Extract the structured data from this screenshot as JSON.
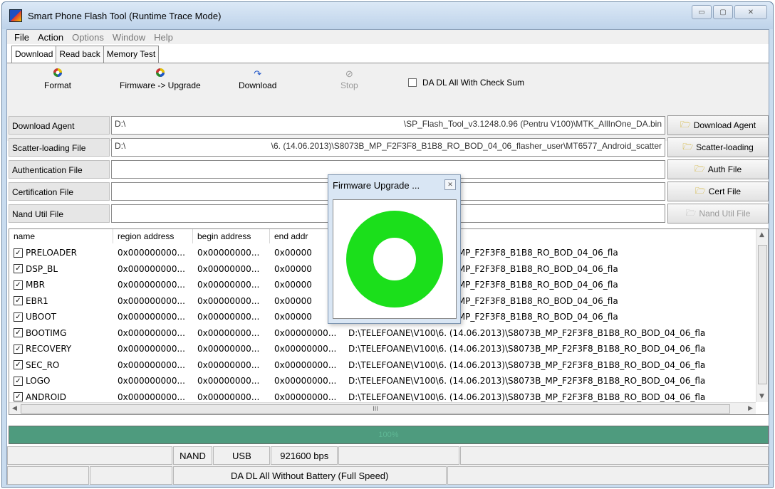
{
  "window": {
    "title": "Smart Phone Flash Tool (Runtime Trace Mode)",
    "minimize_glyph": "▭",
    "maximize_glyph": "▢",
    "close_glyph": "✕"
  },
  "menu": [
    "File",
    "Action",
    "Options",
    "Window",
    "Help"
  ],
  "tabs": [
    "Download",
    "Read back",
    "Memory Test"
  ],
  "toolbar": {
    "format": "Format",
    "firmware_upgrade": "Firmware -> Upgrade",
    "download": "Download",
    "stop": "Stop",
    "checksum_label": "DA DL All With Check Sum",
    "checksum_checked": false
  },
  "files": [
    {
      "label": "Download Agent",
      "path_left": "D:\\",
      "path_right": "\\SP_Flash_Tool_v3.1248.0.96 (Pentru V100)\\MTK_AllInOne_DA.bin",
      "button": "Download Agent",
      "enabled": true
    },
    {
      "label": "Scatter-loading File",
      "path_left": "D:\\",
      "path_right": "\\6. (14.06.2013)\\S8073B_MP_F2F3F8_B1B8_RO_BOD_04_06_flasher_user\\MT6577_Android_scatter",
      "button": "Scatter-loading",
      "enabled": true
    },
    {
      "label": "Authentication File",
      "path_left": "",
      "path_right": "",
      "button": "Auth File",
      "enabled": true
    },
    {
      "label": "Certification File",
      "path_left": "",
      "path_right": "",
      "button": "Cert File",
      "enabled": true
    },
    {
      "label": "Nand Util File",
      "path_left": "",
      "path_right": "",
      "button": "Nand Util File",
      "enabled": false
    }
  ],
  "table": {
    "headers": [
      "name",
      "region address",
      "begin address",
      "end addr",
      ""
    ],
    "rows": [
      {
        "name": "PRELOADER",
        "region": "0x000000000...",
        "begin": "0x00000000...",
        "end": "0x00000",
        "location": "\\6. (14.06.2013)\\S8073B_MP_F2F3F8_B1B8_RO_BOD_04_06_fla"
      },
      {
        "name": "DSP_BL",
        "region": "0x000000000...",
        "begin": "0x00000000...",
        "end": "0x00000",
        "location": "\\6. (14.06.2013)\\S8073B_MP_F2F3F8_B1B8_RO_BOD_04_06_fla"
      },
      {
        "name": "MBR",
        "region": "0x000000000...",
        "begin": "0x00000000...",
        "end": "0x00000",
        "location": "\\6. (14.06.2013)\\S8073B_MP_F2F3F8_B1B8_RO_BOD_04_06_fla"
      },
      {
        "name": "EBR1",
        "region": "0x000000000...",
        "begin": "0x00000000...",
        "end": "0x00000",
        "location": "\\6. (14.06.2013)\\S8073B_MP_F2F3F8_B1B8_RO_BOD_04_06_fla"
      },
      {
        "name": "UBOOT",
        "region": "0x000000000...",
        "begin": "0x00000000...",
        "end": "0x00000",
        "location": "\\6. (14.06.2013)\\S8073B_MP_F2F3F8_B1B8_RO_BOD_04_06_fla"
      },
      {
        "name": "BOOTIMG",
        "region": "0x000000000...",
        "begin": "0x00000000...",
        "end": "0x00000000...",
        "location": "D:\\TELEFOANE\\V100\\6. (14.06.2013)\\S8073B_MP_F2F3F8_B1B8_RO_BOD_04_06_fla"
      },
      {
        "name": "RECOVERY",
        "region": "0x000000000...",
        "begin": "0x00000000...",
        "end": "0x00000000...",
        "location": "D:\\TELEFOANE\\V100\\6. (14.06.2013)\\S8073B_MP_F2F3F8_B1B8_RO_BOD_04_06_fla"
      },
      {
        "name": "SEC_RO",
        "region": "0x000000000...",
        "begin": "0x00000000...",
        "end": "0x00000000...",
        "location": "D:\\TELEFOANE\\V100\\6. (14.06.2013)\\S8073B_MP_F2F3F8_B1B8_RO_BOD_04_06_fla"
      },
      {
        "name": "LOGO",
        "region": "0x000000000...",
        "begin": "0x00000000...",
        "end": "0x00000000...",
        "location": "D:\\TELEFOANE\\V100\\6. (14.06.2013)\\S8073B_MP_F2F3F8_B1B8_RO_BOD_04_06_fla"
      },
      {
        "name": "ANDROID",
        "region": "0x000000000...",
        "begin": "0x00000000...",
        "end": "0x00000000...",
        "location": "D:\\TELEFOANE\\V100\\6. (14.06.2013)\\S8073B_MP_F2F3F8_B1B8_RO_BOD_04_06_fla"
      }
    ],
    "hscroll_label": "III"
  },
  "progress": {
    "percent": 100,
    "label": "100%",
    "fill_color": "#4e9b7e"
  },
  "status": {
    "storage": "NAND",
    "interface": "USB",
    "baud": "921600 bps",
    "mode": "DA DL All Without Battery (Full Speed)"
  },
  "dialog": {
    "title": "Firmware Upgrade ...",
    "close_glyph": "✕",
    "ring_color": "#1bdf1b"
  }
}
